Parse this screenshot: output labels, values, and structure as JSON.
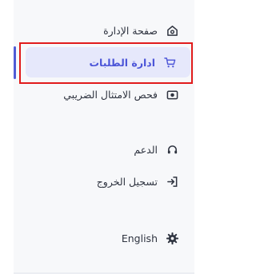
{
  "sidebar": {
    "items": [
      {
        "label": "صفحة الإدارة",
        "icon": "home-icon",
        "active": false
      },
      {
        "label": "ادارة الطلبات",
        "icon": "cart-icon",
        "active": true
      },
      {
        "label": "فحص الامتثال الضريبي",
        "icon": "camera-icon",
        "active": false
      },
      {
        "label": "الدعم",
        "icon": "headset-icon",
        "active": false
      },
      {
        "label": "تسجيل الخروج",
        "icon": "logout-icon",
        "active": false
      },
      {
        "label": "English",
        "icon": "gear-icon",
        "active": false
      }
    ]
  },
  "colors": {
    "accent": "#4c55d8",
    "active_bg": "#e6e8fb",
    "highlight": "#e11b1b"
  }
}
